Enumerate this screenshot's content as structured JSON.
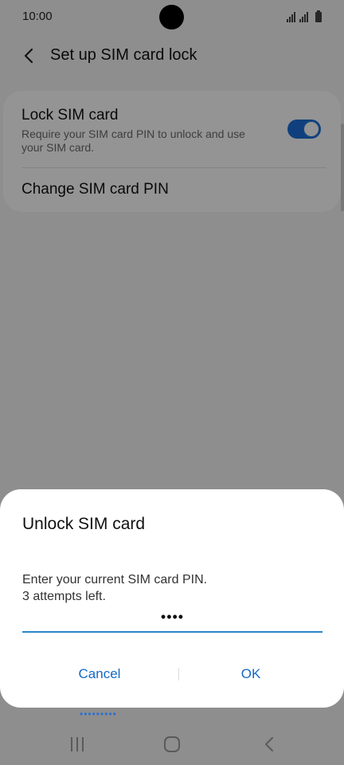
{
  "status_bar": {
    "time": "10:00"
  },
  "app_bar": {
    "title": "Set up SIM card lock"
  },
  "settings": {
    "lock_sim": {
      "title": "Lock SIM card",
      "summary": "Require your SIM card PIN to unlock and use your SIM card.",
      "enabled": true
    },
    "change_pin": {
      "title": "Change SIM card PIN"
    }
  },
  "dialog": {
    "title": "Unlock SIM card",
    "message_line1": "Enter your current SIM card PIN.",
    "message_line2": "3 attempts left.",
    "pin_value": "••••",
    "cancel_label": "Cancel",
    "ok_label": "OK"
  },
  "background_peek": {
    "dots": "•••••••••"
  },
  "colors": {
    "accent": "#1468c6",
    "toggle_on": "#1a6fd8",
    "input_underline": "#2a86c9"
  },
  "icons": {
    "back": "back-arrow-icon",
    "signal": "signal-icon",
    "battery": "battery-icon",
    "nav_recents": "recents-icon",
    "nav_home": "home-icon",
    "nav_back": "nav-back-icon"
  }
}
